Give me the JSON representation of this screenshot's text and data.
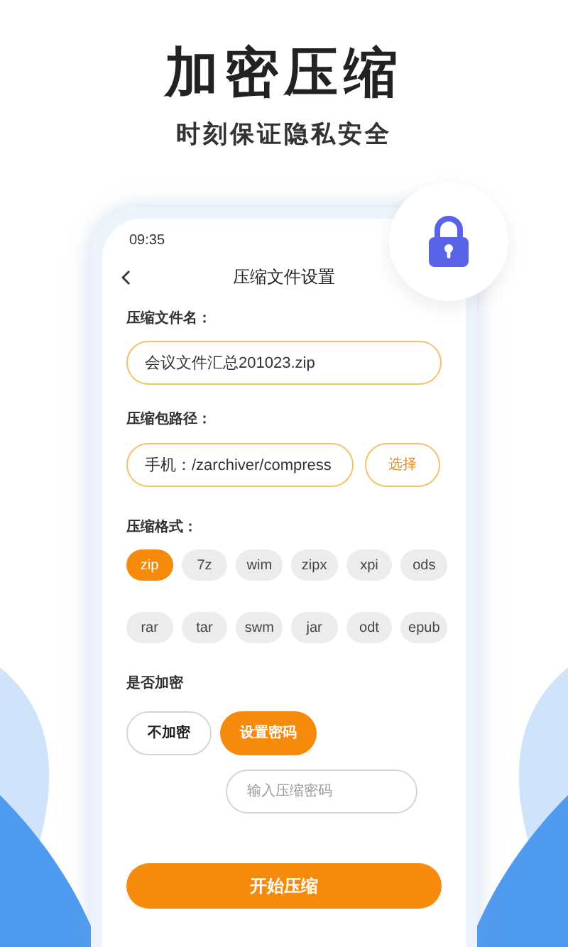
{
  "header": {
    "title": "加密压缩",
    "subtitle": "时刻保证隐私安全"
  },
  "status_bar": {
    "time": "09:35"
  },
  "nav": {
    "title": "压缩文件设置"
  },
  "file_name": {
    "label": "压缩文件名：",
    "value": "会议文件汇总201023.zip"
  },
  "path": {
    "label": "压缩包路径：",
    "value": "手机：/zarchiver/compress",
    "button": "选择"
  },
  "formats": {
    "label": "压缩格式：",
    "items": [
      {
        "label": "zip",
        "selected": true
      },
      {
        "label": "7z",
        "selected": false
      },
      {
        "label": "wim",
        "selected": false
      },
      {
        "label": "zipx",
        "selected": false
      },
      {
        "label": "xpi",
        "selected": false
      },
      {
        "label": "ods",
        "selected": false
      },
      {
        "label": "rar",
        "selected": false
      },
      {
        "label": "tar",
        "selected": false
      },
      {
        "label": "swm",
        "selected": false
      },
      {
        "label": "jar",
        "selected": false
      },
      {
        "label": "odt",
        "selected": false
      },
      {
        "label": "epub",
        "selected": false
      }
    ]
  },
  "encryption": {
    "label": "是否加密",
    "options": [
      {
        "label": "不加密",
        "selected": false
      },
      {
        "label": "设置密码",
        "selected": true
      }
    ],
    "password": {
      "placeholder": "输入压缩密码"
    }
  },
  "start_button": "开始压缩"
}
